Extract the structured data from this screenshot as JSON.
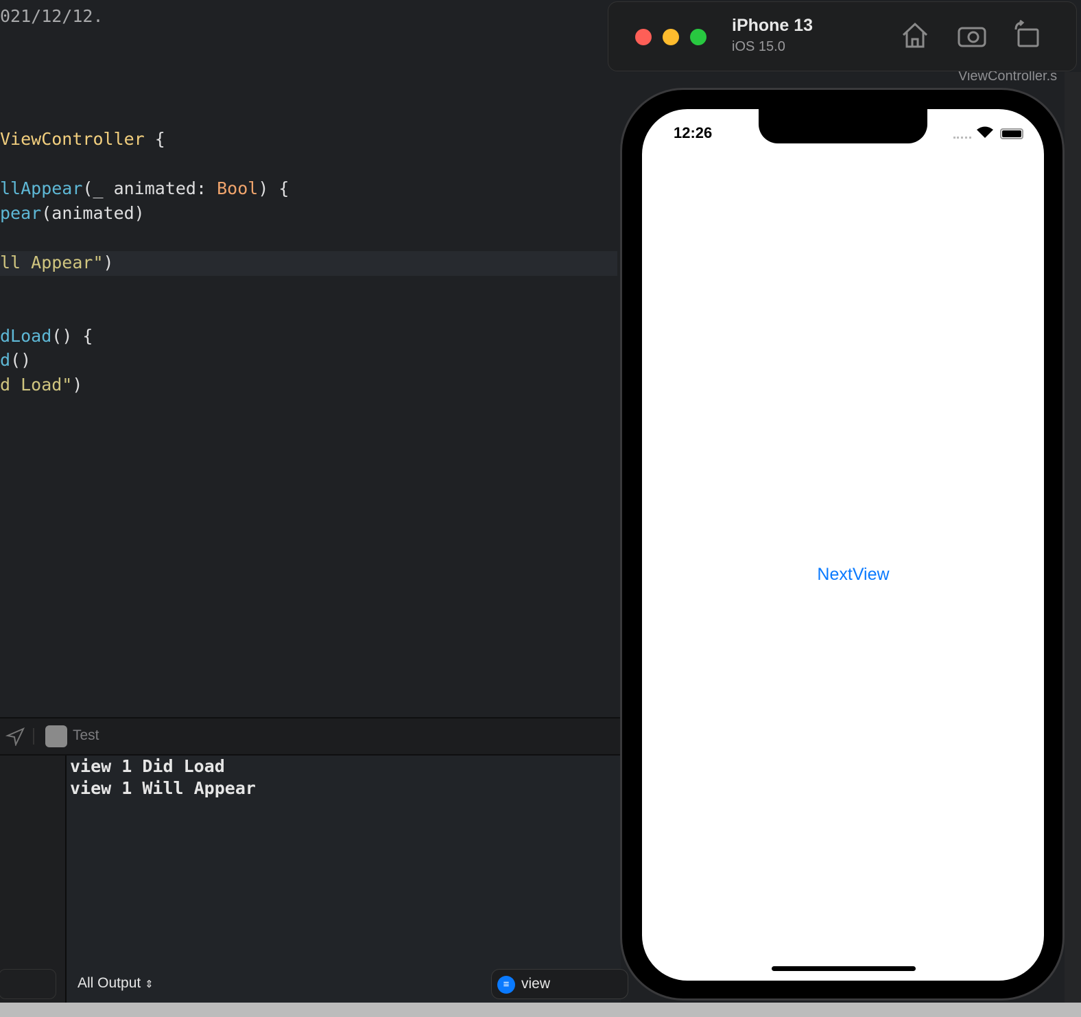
{
  "editor": {
    "lines": [
      {
        "parts": [
          "021/12/12."
        ]
      },
      {
        "parts": [
          "ViewController",
          " {"
        ]
      },
      {
        "parts": [
          "llAppear",
          "(_ animated: ",
          "Bool",
          ") {"
        ]
      },
      {
        "parts": [
          "pear",
          "(animated)"
        ]
      },
      {
        "parts": [
          "ll Appear\"",
          ")"
        ]
      },
      {
        "parts": [
          "dLoad",
          "() {"
        ]
      },
      {
        "parts": [
          "d",
          "()"
        ]
      },
      {
        "parts": [
          "d Load\"",
          ")"
        ]
      }
    ]
  },
  "debug": {
    "scheme": "Test",
    "output": [
      "view 1 Did Load",
      "view 1 Will Appear"
    ],
    "output_filter": "All Output",
    "search_value": "view"
  },
  "simulator": {
    "device": "iPhone 13",
    "os": "iOS 15.0",
    "time": "12:26",
    "button": "NextView",
    "accent": "#0a7aff",
    "behind_title": "ViewController.s"
  }
}
